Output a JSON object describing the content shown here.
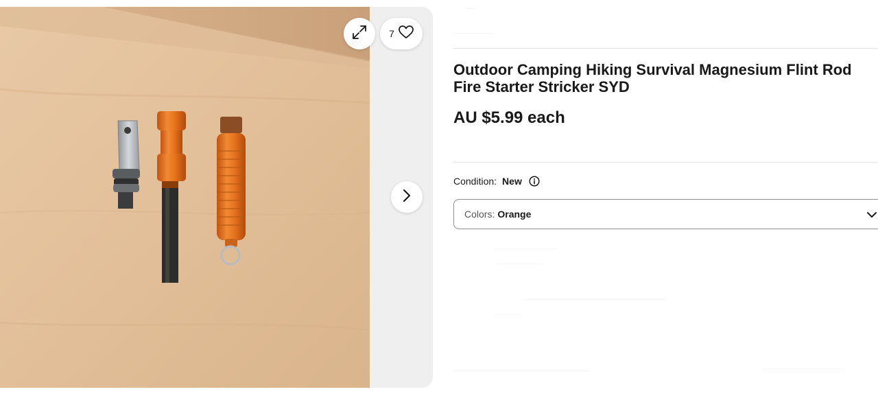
{
  "gallery": {
    "watch_count": "7",
    "icons": {
      "expand": "expand-icon",
      "heart": "heart-icon",
      "next": "chevron-right-icon"
    },
    "product_colors": {
      "orange": "#e8741f",
      "wood": "#e0bd98"
    }
  },
  "listing": {
    "title": "Outdoor Camping Hiking Survival Magnesium Flint Rod Fire Starter Stricker SYD",
    "price": "AU $5.99 each",
    "condition_label": "Condition:",
    "condition_value": "New",
    "variation": {
      "label": "Colors:",
      "selected": "Orange"
    }
  }
}
